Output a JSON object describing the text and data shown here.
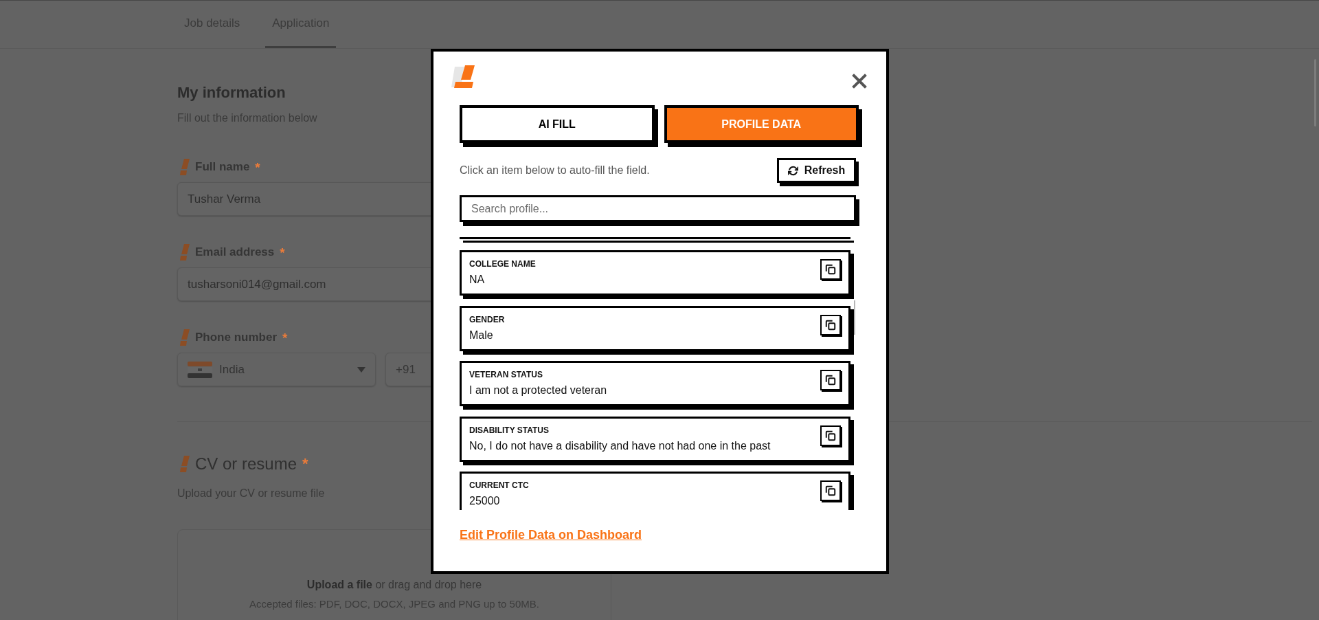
{
  "page": {
    "tabs": [
      {
        "label": "Job details",
        "selected": false
      },
      {
        "label": "Application",
        "selected": true
      }
    ],
    "section": {
      "title": "My information",
      "subtitle": "Fill out the information below"
    },
    "fields": [
      {
        "kind": "text",
        "label": "Full name",
        "required_mark": "*",
        "value": "Tushar Verma"
      },
      {
        "kind": "text",
        "label": "Email address",
        "required_mark": "*",
        "value": "tusharsoni014@gmail.com"
      },
      {
        "kind": "phone",
        "label": "Phone number",
        "required_mark": "*",
        "country": "India",
        "placeholder": "+91"
      }
    ],
    "upload": {
      "title": "CV or resume",
      "required_mark": "*",
      "subtitle": "Upload your CV or resume file",
      "link": "Upload a file",
      "prompt": "or drag and drop here",
      "note": "Accepted files: PDF, DOC, DOCX, JPEG and PNG up to 50MB."
    }
  },
  "modal": {
    "tabs": [
      {
        "label": "AI FILL",
        "selected": false
      },
      {
        "label": "PROFILE DATA",
        "selected": true
      }
    ],
    "hint": "Click an item below to auto-fill the field.",
    "refresh_button": "Refresh",
    "search": {
      "placeholder": "Search profile..."
    },
    "items": [
      {
        "label": "COLLEGE NAME",
        "value": "NA"
      },
      {
        "label": "GENDER",
        "value": "Male"
      },
      {
        "label": "VETERAN STATUS",
        "value": "I am not a protected veteran"
      },
      {
        "label": "DISABILITY STATUS",
        "value": "No, I do not have a disability and have not had one in the past"
      },
      {
        "label": "CURRENT CTC",
        "value": "25000"
      }
    ],
    "link": "Edit Profile Data on Dashboard"
  }
}
